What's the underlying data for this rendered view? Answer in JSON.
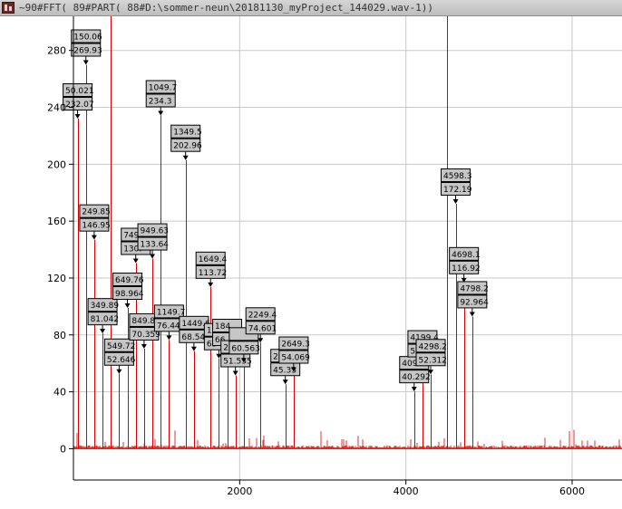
{
  "window": {
    "title": "~90#FFT( 89#PART( 88#D:\\sommer-neun\\20181130_myProject_144029.wav-1))"
  },
  "colors": {
    "signal": "#dd0000",
    "baseline": "#2e9e2e",
    "grid": "#c8c8c8",
    "label_box": "#c6c6c6"
  },
  "chart_data": {
    "type": "line",
    "x_ticks": [
      2000,
      4000,
      6000
    ],
    "y_ticks": [
      0,
      40,
      80,
      120,
      160,
      200,
      240,
      280
    ],
    "xlim": [
      0,
      6600
    ],
    "ylim": [
      -22,
      304
    ],
    "grid": true,
    "series": [
      {
        "peaks": [
          {
            "x": 50.021,
            "y": 232.07
          },
          {
            "x": 150.06,
            "y": 269.93
          },
          {
            "x": 249.85,
            "y": 146.95
          },
          {
            "x": 349.89,
            "y": 81.042
          },
          {
            "x": 449.8,
            "y": 310
          },
          {
            "x": 549.72,
            "y": 52.646
          },
          {
            "x": 649.76,
            "y": 98.964
          },
          {
            "x": 749.6,
            "y": 130.5
          },
          {
            "x": 849.8,
            "y": 70.359
          },
          {
            "x": 949.63,
            "y": 133.64
          },
          {
            "x": 1049.7,
            "y": 234.3
          },
          {
            "x": 1149.7,
            "y": 76.447
          },
          {
            "x": 1349.5,
            "y": 202.96
          },
          {
            "x": 1449.6,
            "y": 68.544
          },
          {
            "x": 1649.4,
            "y": 113.72
          },
          {
            "x": 1749.6,
            "y": 63.5
          },
          {
            "x": 1849.5,
            "y": 66.5
          },
          {
            "x": 1949.4,
            "y": 51.535
          },
          {
            "x": 2049.4,
            "y": 60.563
          },
          {
            "x": 2249.4,
            "y": 74.601
          },
          {
            "x": 2549.3,
            "y": 45.33
          },
          {
            "x": 2649.3,
            "y": 54.069
          },
          {
            "x": 4099.2,
            "y": 40.292
          },
          {
            "x": 4199.2,
            "y": 58.5
          },
          {
            "x": 4298.2,
            "y": 52.312
          },
          {
            "x": 4498.3,
            "y": 310
          },
          {
            "x": 4598.3,
            "y": 172.19
          },
          {
            "x": 4698.1,
            "y": 116.92
          },
          {
            "x": 4798.2,
            "y": 92.964
          }
        ]
      }
    ],
    "annotations": [
      {
        "x": 150.06,
        "y": 269.93,
        "lines": [
          "150.06",
          "269.93"
        ]
      },
      {
        "x": 50.021,
        "y": 232.07,
        "lines": [
          "50.021",
          "232.07"
        ]
      },
      {
        "x": 249.85,
        "y": 146.95,
        "lines": [
          "249.85",
          "146.95"
        ]
      },
      {
        "x": 349.89,
        "y": 81.042,
        "lines": [
          "349.89",
          "81.042"
        ]
      },
      {
        "x": 549.72,
        "y": 52.646,
        "lines": [
          "549.72",
          "52.646"
        ]
      },
      {
        "x": 649.76,
        "y": 98.964,
        "lines": [
          "649.76",
          "98.964"
        ]
      },
      {
        "x": 749.6,
        "y": 130.5,
        "lines": [
          "749",
          "130."
        ]
      },
      {
        "x": 849.8,
        "y": 70.359,
        "lines": [
          "849.84",
          "70.359"
        ]
      },
      {
        "x": 949.63,
        "y": 133.64,
        "lines": [
          "949.63",
          "133.64"
        ]
      },
      {
        "x": 1049.7,
        "y": 234.3,
        "lines": [
          "1049.7",
          "234.3"
        ]
      },
      {
        "x": 1149.7,
        "y": 76.447,
        "lines": [
          "1149.7",
          "76.447"
        ]
      },
      {
        "x": 1349.5,
        "y": 202.96,
        "lines": [
          "1349.5",
          "202.96"
        ]
      },
      {
        "x": 1449.6,
        "y": 68.544,
        "lines": [
          "1449.6",
          "68.544"
        ]
      },
      {
        "x": 1649.4,
        "y": 113.72,
        "lines": [
          "1649.4",
          "113.72"
        ]
      },
      {
        "x": 1749.6,
        "y": 63.5,
        "lines": [
          "17",
          "63"
        ]
      },
      {
        "x": 1849.5,
        "y": 66.5,
        "lines": [
          "184",
          "66"
        ]
      },
      {
        "x": 1949.4,
        "y": 51.535,
        "lines": [
          "2049",
          "51.535"
        ]
      },
      {
        "x": 2049.4,
        "y": 60.563,
        "lines": [
          "",
          "60.563"
        ]
      },
      {
        "x": 2249.4,
        "y": 74.601,
        "lines": [
          "2249.4",
          "74.601"
        ]
      },
      {
        "x": 2549.3,
        "y": 45.33,
        "lines": [
          "25",
          "45.33"
        ]
      },
      {
        "x": 2649.3,
        "y": 54.069,
        "lines": [
          "2649.3",
          "54.069"
        ]
      },
      {
        "x": 4099.2,
        "y": 40.292,
        "lines": [
          "409",
          "40.292"
        ]
      },
      {
        "x": 4199.2,
        "y": 58.5,
        "lines": [
          "4199.4",
          "5"
        ]
      },
      {
        "x": 4298.2,
        "y": 52.312,
        "lines": [
          "4298.2",
          "52.312"
        ]
      },
      {
        "x": 4598.3,
        "y": 172.19,
        "lines": [
          "4598.3",
          "172.19"
        ]
      },
      {
        "x": 4698.1,
        "y": 116.92,
        "lines": [
          "4698.1",
          "116.92"
        ]
      },
      {
        "x": 4798.2,
        "y": 92.964,
        "lines": [
          "4798.2",
          "92.964"
        ]
      }
    ]
  }
}
